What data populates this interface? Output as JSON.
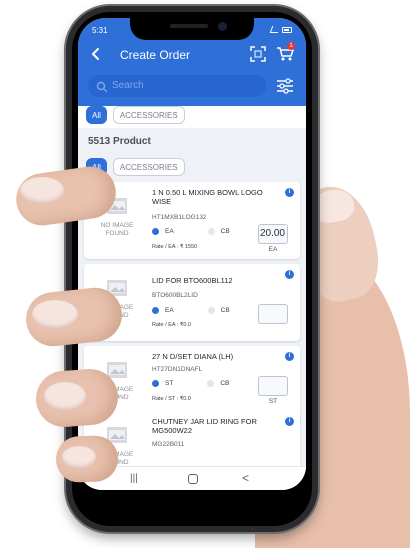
{
  "status_bar": {
    "time": "5:31"
  },
  "header": {
    "title": "Create Order",
    "cart_badge_count": "1"
  },
  "search": {
    "placeholder": "Search"
  },
  "top_tabs": [
    {
      "label": "All",
      "active": true
    },
    {
      "label": "ACCESSORIES",
      "active": false
    }
  ],
  "product_count": "5513 Product",
  "filter_tabs": [
    {
      "label": "All",
      "active": true
    },
    {
      "label": "ACCESSORIES",
      "active": false
    }
  ],
  "products": [
    {
      "name": "1 N 0.50 L MIXING BOWL LOGO WISE",
      "code": "HT1MXB1LOG132",
      "image_text": "NO IMAGE FOUND",
      "options": [
        "EA",
        "CB"
      ],
      "selected": "EA",
      "rate": "Rate / EA : ₹ 1550",
      "qty": "20.00",
      "unit": "EA"
    },
    {
      "name": "LID FOR BTO600BL112",
      "code": "BTO600BL2LID",
      "image_text": "NO IMAGE FOUND",
      "options": [
        "EA",
        "CB"
      ],
      "selected": "EA",
      "rate": "Rate / EA : ₹0.0",
      "qty": "",
      "unit": ""
    },
    {
      "name": "27 N D/SET DIANA (LH)",
      "code": "HT27DN1DNAFL",
      "image_text": "NO IMAGE FOUND",
      "options": [
        "ST",
        "CB"
      ],
      "selected": "ST",
      "rate": "Rate / ST : ₹0.0",
      "qty": "",
      "unit": "ST"
    },
    {
      "name": "CHUTNEY JAR LID RING FOR MG500W22",
      "code": "MG22B011",
      "image_text": "NO IMAGE FOUND",
      "options": [],
      "selected": "",
      "rate": "",
      "qty": "",
      "unit": ""
    }
  ],
  "nav_bar": {
    "recent": "|||",
    "back": "<"
  },
  "colors": {
    "primary": "#2f6fd8",
    "screen_bg": "#eef1f6",
    "skin": "#e7bfaa"
  }
}
